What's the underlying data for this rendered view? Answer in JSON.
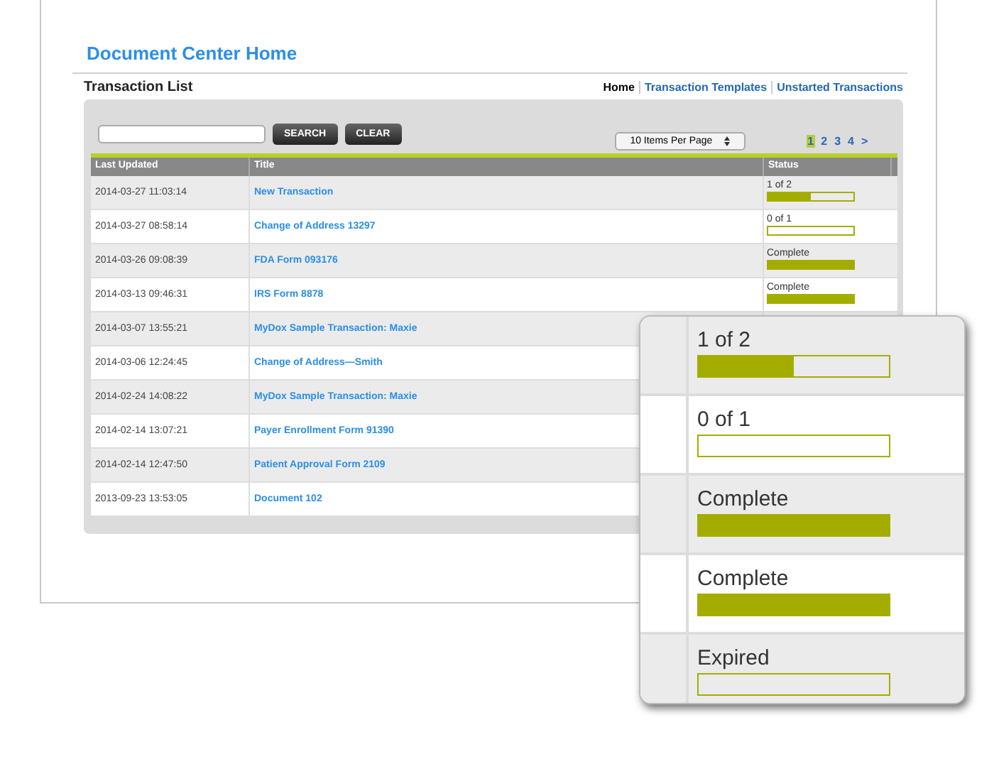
{
  "header": {
    "title": "Document Center Home"
  },
  "section": {
    "title": "Transaction List"
  },
  "nav": [
    {
      "label": "Home",
      "selected": true
    },
    {
      "label": "Transaction Templates",
      "selected": false
    },
    {
      "label": "Unstarted Transactions",
      "selected": false
    }
  ],
  "toolbar": {
    "search_button": "SEARCH",
    "clear_button": "CLEAR",
    "page_size": "10 Items Per Page",
    "pages": [
      {
        "label": "1",
        "selected": true
      },
      {
        "label": "2",
        "selected": false
      },
      {
        "label": "3",
        "selected": false
      },
      {
        "label": "4",
        "selected": false
      },
      {
        "label": ">",
        "selected": false
      }
    ]
  },
  "table": {
    "columns": [
      "Last Updated",
      "Title",
      "Status"
    ],
    "rows": [
      {
        "updated": "2014-03-27 11:03:14",
        "title": "New Transaction",
        "status": "1 of 2",
        "level": 0.5
      },
      {
        "updated": "2014-03-27 08:58:14",
        "title": "Change of Address 13297",
        "status": "0 of 1",
        "level": 0
      },
      {
        "updated": "2014-03-26 09:08:39",
        "title": "FDA Form 093176",
        "status": "Complete",
        "level": 1
      },
      {
        "updated": "2014-03-13 09:46:31",
        "title": "IRS Form 8878",
        "status": "Complete",
        "level": 1
      },
      {
        "updated": "2014-03-07 13:55:21",
        "title": "MyDox Sample Transaction: Maxie"
      },
      {
        "updated": "2014-03-06 12:24:45",
        "title": "Change of Address—Smith"
      },
      {
        "updated": "2014-02-24 14:08:22",
        "title": "MyDox Sample Transaction: Maxie"
      },
      {
        "updated": "2014-02-14 13:07:21",
        "title": "Payer Enrollment Form 91390"
      },
      {
        "updated": "2014-02-14 12:47:50",
        "title": "Patient Approval Form 2109"
      },
      {
        "updated": "2013-09-23 13:53:05",
        "title": "Document 102"
      }
    ]
  },
  "magnifier": {
    "items": [
      {
        "status": "1 of 2",
        "level": 0.5
      },
      {
        "status": "0 of 1",
        "level": 0
      },
      {
        "status": "Complete",
        "level": 1
      },
      {
        "status": "Complete",
        "level": 1
      },
      {
        "status": "Expired",
        "level": 0
      }
    ]
  }
}
